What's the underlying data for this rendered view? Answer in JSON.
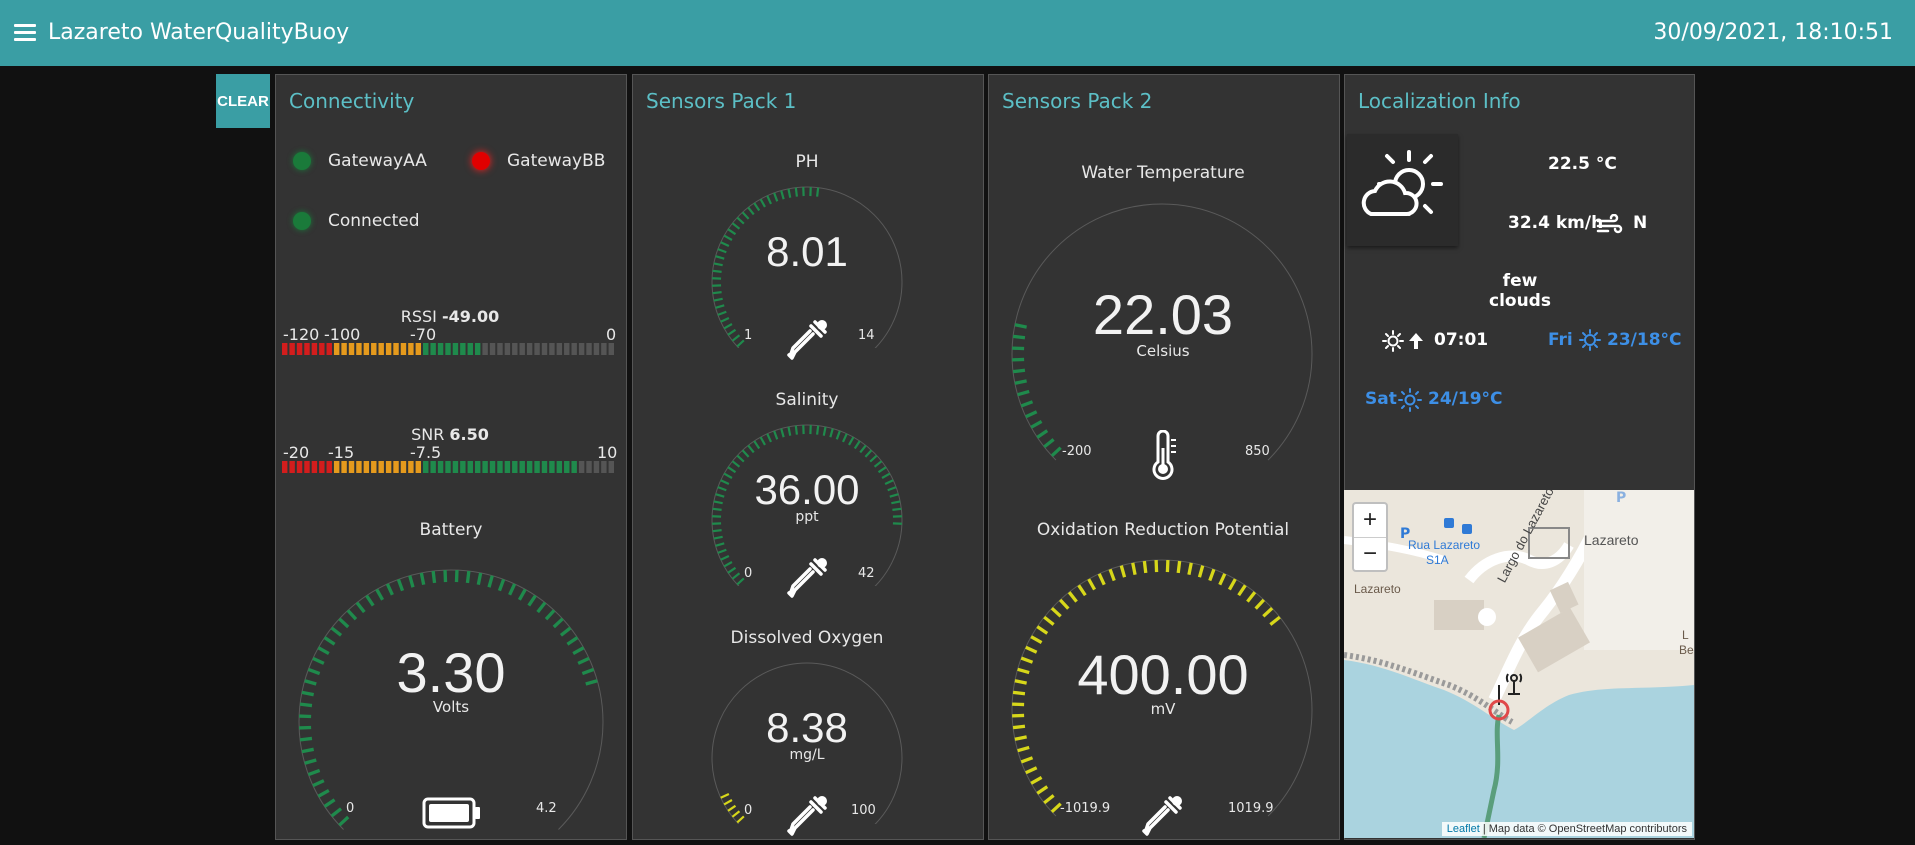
{
  "header": {
    "title": "Lazareto WaterQualityBuoy",
    "datetime": "30/09/2021, 18:10:51"
  },
  "clear_label": "CLEAR",
  "colors": {
    "header": "#3a9ea4",
    "title_accent": "#5cbfc6",
    "card_bg": "#333333",
    "page_bg": "#111111",
    "green": "#1f8a4c",
    "red": "#d31d1d",
    "orange": "#e59a1d",
    "yellow": "#d7d71a",
    "link_blue": "#3d8fe6"
  },
  "connectivity": {
    "title": "Connectivity",
    "leds": [
      {
        "label": "GatewayAA",
        "state": "green"
      },
      {
        "label": "GatewayBB",
        "state": "red"
      },
      {
        "label": "Connected",
        "state": "green"
      }
    ],
    "rssi": {
      "label": "RSSI",
      "value": "-49.00",
      "ticks": [
        "-120",
        "-100",
        "-70",
        "0"
      ],
      "min": -120,
      "max": 0,
      "numeric": -49
    },
    "snr": {
      "label": "SNR",
      "value": "6.50",
      "ticks": [
        "-20",
        "-15",
        "-7.5",
        "10"
      ],
      "min": -20,
      "max": 10,
      "numeric": 6.5
    },
    "battery": {
      "title": "Battery",
      "value": "3.30",
      "unit": "Volts",
      "min": "0",
      "max": "4.2",
      "fraction": 0.786,
      "icon": "battery-icon"
    }
  },
  "pack1": {
    "title": "Sensors Pack 1",
    "ph": {
      "title": "PH",
      "value": "8.01",
      "min": "1",
      "max": "14",
      "fraction": 0.539,
      "icon": "dropper-icon"
    },
    "salinity": {
      "title": "Salinity",
      "value": "36.00",
      "unit": "ppt",
      "min": "0",
      "max": "42",
      "fraction": 0.857,
      "icon": "dropper-icon"
    },
    "oxygen": {
      "title": "Dissolved Oxygen",
      "value": "8.38",
      "unit": "mg/L",
      "min": "0",
      "max": "100",
      "fraction": 0.084,
      "icon": "dropper-icon"
    }
  },
  "pack2": {
    "title": "Sensors Pack 2",
    "temperature": {
      "title": "Water Temperature",
      "value": "22.03",
      "unit": "Celsius",
      "min": "-200",
      "max": "850",
      "fraction": 0.211,
      "icon": "thermometer-icon"
    },
    "orp": {
      "title": "Oxidation Reduction Potential",
      "value": "400.00",
      "unit": "mV",
      "min": "-1019.9",
      "max": "1019.9",
      "fraction": 0.696,
      "icon": "dropper-icon"
    }
  },
  "localization": {
    "title": "Localization Info",
    "weather_icon": "partly-cloudy-icon",
    "temperature": "22.5 °C",
    "wind_speed": "32.4 km/h",
    "wind_dir": "N",
    "description": "few clouds",
    "sunrise": "07:01",
    "forecast": [
      {
        "day": "Fri",
        "temps": "23/18°C"
      },
      {
        "day": "Sat",
        "temps": "24/19°C"
      }
    ]
  },
  "map": {
    "zoom_in": "+",
    "zoom_out": "−",
    "labels": {
      "street1": "Rua Lazareto",
      "street1b": "S1A",
      "place1": "Lazareto",
      "place2": "Lazareto",
      "street2": "Largo do Lazareto",
      "edge": "L",
      "edge2": "Be"
    },
    "attribution_link": "Leaflet",
    "attribution_text": "| Map data © OpenStreetMap contributors"
  }
}
